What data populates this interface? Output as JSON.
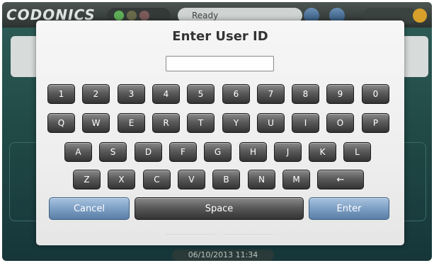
{
  "app": {
    "logo": "CODONICS"
  },
  "topbar": {
    "status": "Ready"
  },
  "footer": {
    "datetime": "06/10/2013 11:34"
  },
  "dialog": {
    "title": "Enter User ID",
    "input_value": "",
    "rows": [
      [
        "1",
        "2",
        "3",
        "4",
        "5",
        "6",
        "7",
        "8",
        "9",
        "0"
      ],
      [
        "Q",
        "W",
        "E",
        "R",
        "T",
        "Y",
        "U",
        "I",
        "O",
        "P"
      ],
      [
        "A",
        "S",
        "D",
        "F",
        "G",
        "H",
        "J",
        "K",
        "L"
      ],
      [
        "Z",
        "X",
        "C",
        "V",
        "B",
        "N",
        "M"
      ]
    ],
    "backspace_label": "←",
    "cancel_label": "Cancel",
    "space_label": "Space",
    "enter_label": "Enter"
  },
  "colors": {
    "dialog_bg": "#eeeeee",
    "key_dark": "#4a4a4a",
    "key_blue": "#7d9fc4"
  }
}
